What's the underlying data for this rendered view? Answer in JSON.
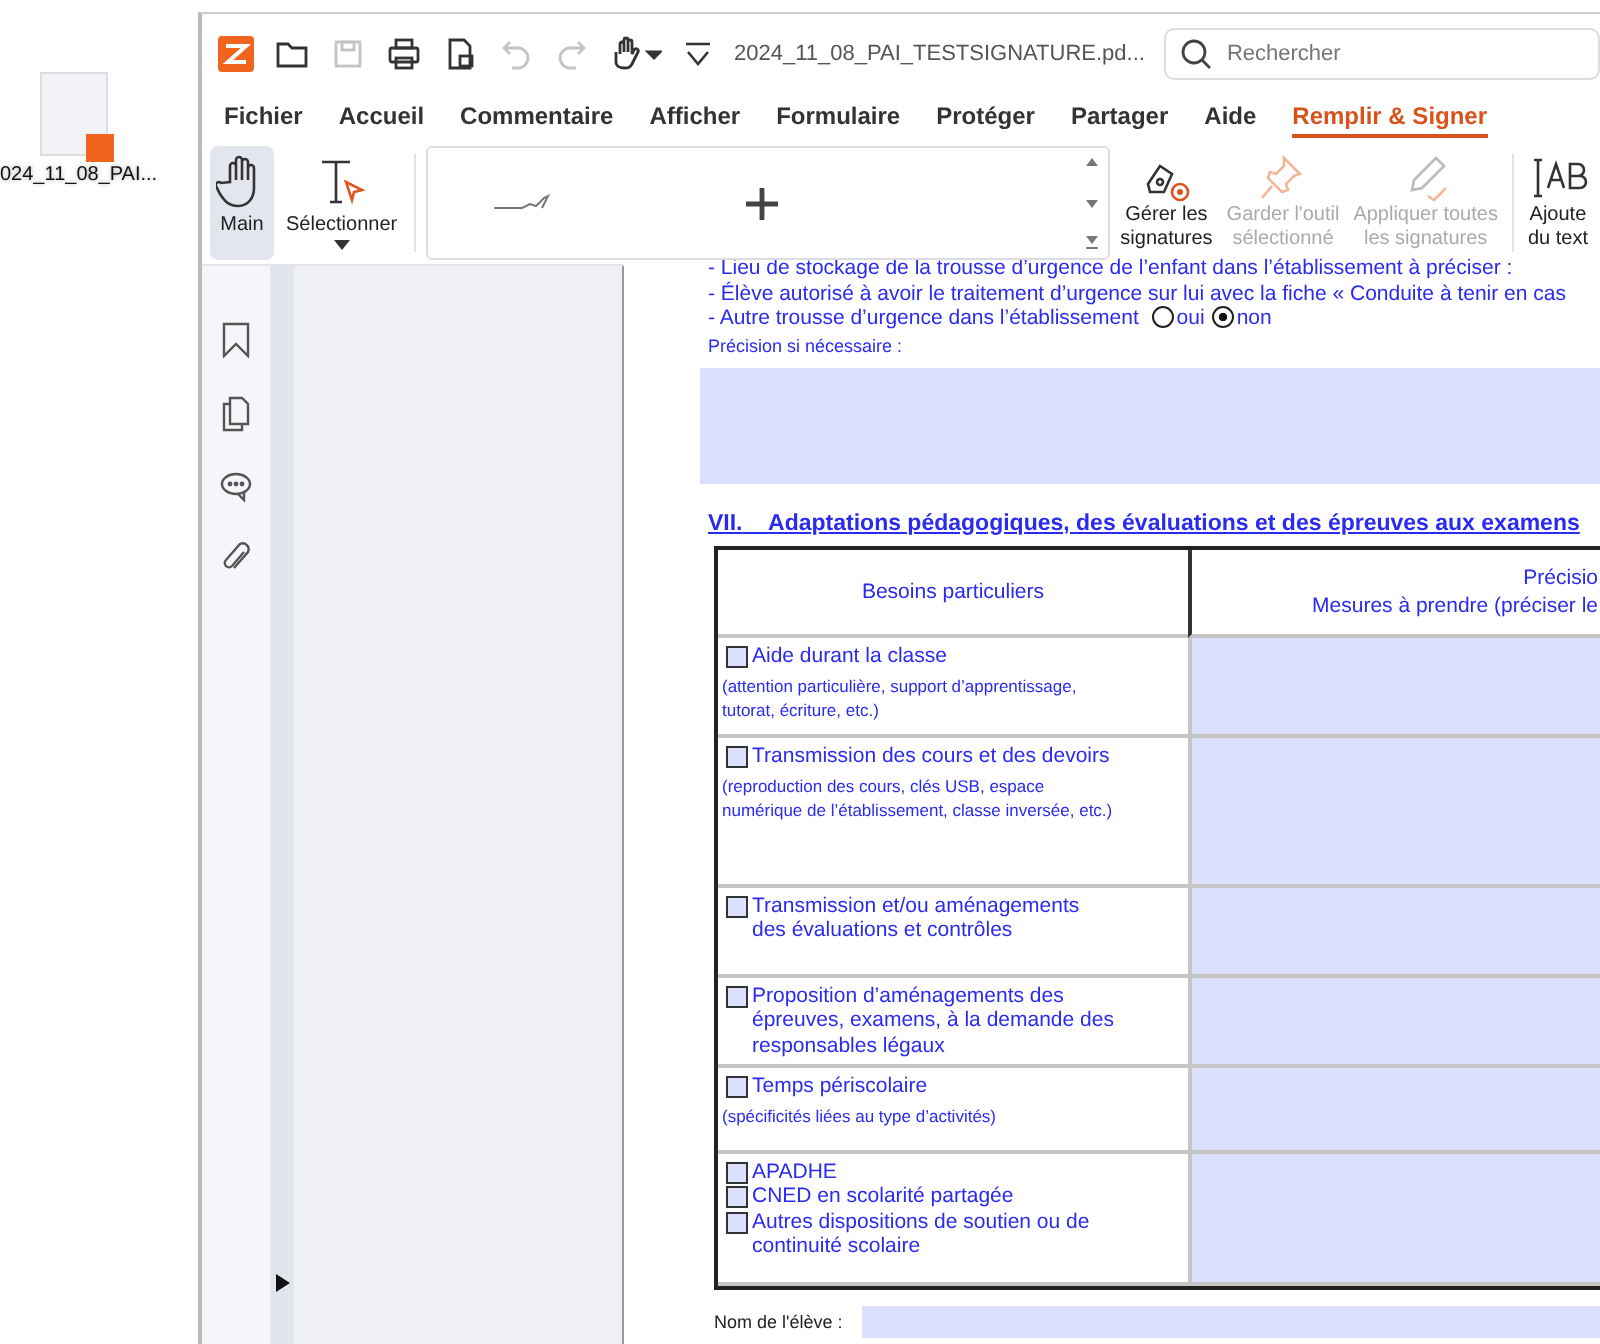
{
  "desktop_icon": {
    "label": "024_11_08_PAI..."
  },
  "window": {
    "title": "2024_11_08_PAI_TESTSIGNATURE.pd...",
    "search": {
      "placeholder": "Rechercher"
    },
    "quick_tools": [
      {
        "kind": "open",
        "disabled": false
      },
      {
        "kind": "save",
        "disabled": true
      },
      {
        "kind": "print",
        "disabled": false
      },
      {
        "kind": "document",
        "disabled": false
      },
      {
        "kind": "undo",
        "disabled": true
      },
      {
        "kind": "redo",
        "disabled": true
      },
      {
        "kind": "hand",
        "disabled": false
      }
    ]
  },
  "tabs": [
    {
      "label": "Fichier",
      "selected": false
    },
    {
      "label": "Accueil",
      "selected": false
    },
    {
      "label": "Commentaire",
      "selected": false
    },
    {
      "label": "Afficher",
      "selected": false
    },
    {
      "label": "Formulaire",
      "selected": false
    },
    {
      "label": "Protéger",
      "selected": false
    },
    {
      "label": "Partager",
      "selected": false
    },
    {
      "label": "Aide",
      "selected": false
    },
    {
      "label": "Remplir & Signer",
      "selected": true
    }
  ],
  "ribbon": {
    "tools": [
      {
        "kind": "hand",
        "label": "Main",
        "selected": true
      },
      {
        "kind": "select",
        "label": "Sélectionner",
        "selected": false
      }
    ],
    "actions": [
      {
        "kind": "manage",
        "label": "Gérer les\nsignatures",
        "disabled": false
      },
      {
        "kind": "pin",
        "label": "Garder l'outil\nsélectionné",
        "disabled": true
      },
      {
        "kind": "apply",
        "label": "Appliquer toutes\nles signatures",
        "disabled": true
      },
      {
        "kind": "text",
        "label": "Ajoute\ndu text",
        "disabled": false
      }
    ]
  },
  "document": {
    "lines": [
      "- Lieu de stockage de la trousse d’urgence de l’enfant dans l’établissement à préciser :",
      "- Élève autorisé à avoir le traitement d’urgence sur lui avec la fiche « Conduite à tenir en cas"
    ],
    "radio_question": {
      "label": "- Autre trousse d’urgence dans l’établissement",
      "options": [
        {
          "label": "oui",
          "selected": false
        },
        {
          "label": "non",
          "selected": true
        }
      ]
    },
    "precision_label": "Précision si nécessaire :",
    "section_heading": {
      "number": "VII.",
      "title": "Adaptations pédagogiques, des évaluations et des épreuves aux examens"
    },
    "table": {
      "header_left": "Besoins particuliers",
      "header_right": [
        "Précisio",
        "Mesures à prendre (préciser le"
      ],
      "rows": [
        {
          "items": [
            {
              "label": "Aide durant la classe",
              "checked": false
            }
          ],
          "note": "(attention particulière, support d’apprentissage,\ntutorat, écriture, etc.)"
        },
        {
          "items": [
            {
              "label": "Transmission des cours et des devoirs",
              "checked": false
            }
          ],
          "note": "(reproduction des cours, clés USB, espace\nnumérique de l’établissement, classe inversée, etc.)"
        },
        {
          "items": [
            {
              "label": "Transmission et/ou aménagements\ndes évaluations et contrôles",
              "checked": false
            }
          ]
        },
        {
          "items": [
            {
              "label": "Proposition d’aménagements des\népreuves, examens, à la demande des\nresponsables légaux",
              "checked": false
            }
          ]
        },
        {
          "items": [
            {
              "label": "Temps périscolaire",
              "checked": false
            }
          ],
          "note": "(spécificités liées au type d’activités)"
        },
        {
          "items": [
            {
              "label": "APADHE",
              "checked": false
            },
            {
              "label": "CNED en scolarité partagée",
              "checked": false
            },
            {
              "label": "Autres dispositions de soutien ou de\ncontinuité scolaire",
              "checked": false
            }
          ]
        }
      ]
    },
    "student_name": {
      "label": "Nom de l'élève :"
    }
  }
}
